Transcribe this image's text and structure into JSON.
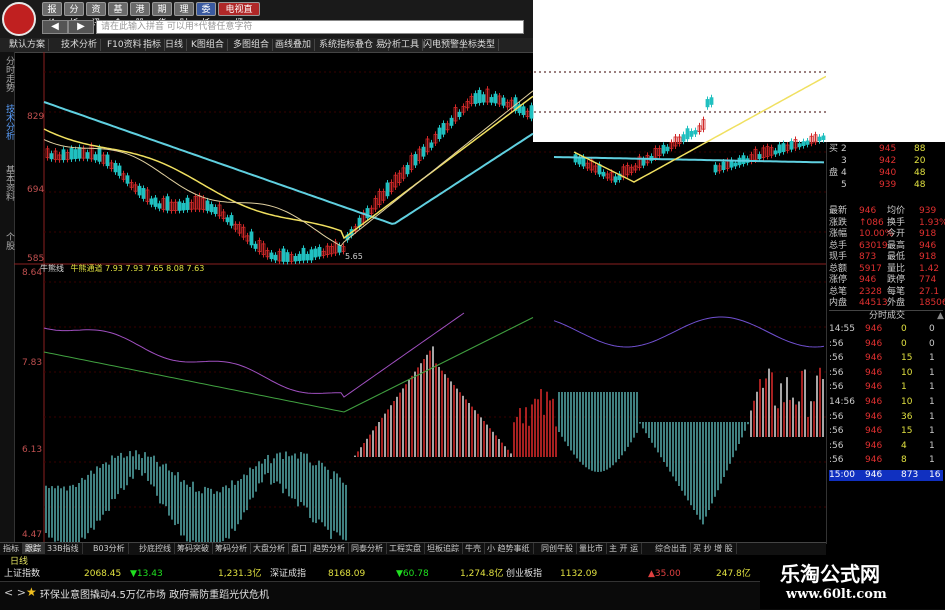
{
  "toolbar_top": {
    "buttons": [
      "报价",
      "分析",
      "资讯",
      "基金",
      "港股",
      "期货",
      "理财",
      "委托",
      "电视直播"
    ],
    "search_placeholder": "请在此输入拼音 可以用*代替任意字符",
    "back": "◀",
    "forward": "▶"
  },
  "toolbar_main": [
    "默认方案",
    "技术分析",
    "F10资料",
    "指标",
    "日线",
    "K图组合",
    "多图组合",
    "画线叠加",
    "系统指标",
    "叠仓 易",
    "分析工具",
    "闪电预警",
    "坐标类型"
  ],
  "left_tabs": [
    "分时走势",
    "技术分析",
    "基本资料",
    "个股"
  ],
  "price_axis_top": [
    "829",
    "694",
    "585"
  ],
  "price_axis_bottom": [
    "8.64",
    "7.83",
    "6.13",
    "4.47"
  ],
  "annotation": "5.65",
  "indicator_name": "牛熊线",
  "indicator_values": "牛熊通道  7.93  7.93  7.65  8.08  7.63",
  "quote": {
    "order_book": [
      {
        "side": "买",
        "level": "2",
        "price": "945",
        "vol": "88"
      },
      {
        "side": "",
        "level": "3",
        "price": "942",
        "vol": "20"
      },
      {
        "side": "盘",
        "level": "4",
        "price": "940",
        "vol": "48"
      },
      {
        "side": "",
        "level": "5",
        "price": "939",
        "vol": "48"
      }
    ],
    "stats": [
      {
        "k1": "最新",
        "v1": "946",
        "k2": "均价",
        "v2": "939"
      },
      {
        "k1": "涨跌",
        "v1": "↑086",
        "k2": "换手",
        "v2": "1.93%"
      },
      {
        "k1": "涨幅",
        "v1": "10.00%",
        "k2": "今开",
        "v2": "918"
      },
      {
        "k1": "总手",
        "v1": "63019",
        "k2": "最高",
        "v2": "946"
      },
      {
        "k1": "现手",
        "v1": "873",
        "k2": "最低",
        "v2": "918"
      },
      {
        "k1": "总额",
        "v1": "5917",
        "k2": "量比",
        "v2": "1.42"
      },
      {
        "k1": "涨停",
        "v1": "946",
        "k2": "跌停",
        "v2": "774"
      },
      {
        "k1": "总笔",
        "v1": "2328",
        "k2": "每笔",
        "v2": "27.1"
      },
      {
        "k1": "内盘",
        "v1": "44513",
        "k2": "外盘",
        "v2": "18506"
      }
    ],
    "ticks_title": "分时成交",
    "ticks": [
      {
        "time": "14:55",
        "price": "946",
        "vol": "0",
        "n": "0"
      },
      {
        "time": ":56",
        "price": "946",
        "vol": "0",
        "n": "0"
      },
      {
        "time": ":56",
        "price": "946",
        "vol": "15",
        "n": "1"
      },
      {
        "time": ":56",
        "price": "946",
        "vol": "10",
        "n": "1"
      },
      {
        "time": ":56",
        "price": "946",
        "vol": "1",
        "n": "1"
      },
      {
        "time": "14:56",
        "price": "946",
        "vol": "10",
        "n": "1"
      },
      {
        "time": ":56",
        "price": "946",
        "vol": "36",
        "n": "1"
      },
      {
        "time": ":56",
        "price": "946",
        "vol": "15",
        "n": "1"
      },
      {
        "time": ":56",
        "price": "946",
        "vol": "4",
        "n": "1"
      },
      {
        "time": ":56",
        "price": "946",
        "vol": "8",
        "n": "1"
      },
      {
        "time": "15:00",
        "price": "946",
        "vol": "873",
        "n": "16"
      }
    ]
  },
  "bottom_tabs": [
    "指标",
    "跟踪",
    "33B指线",
    "B03分析",
    "抄底控线",
    "筹码突破",
    "筹码分析",
    "大盘分析",
    "盘口",
    "趋势分析",
    "同泰分析",
    "工程实盘",
    "坦板追踪",
    "牛壳",
    "小 趋势事纸",
    "同创牛股",
    "量比市",
    "主 开 运",
    "综合出击",
    "买 抄 增 股"
  ],
  "status_line": [
    {
      "name": "上证指数",
      "value": "2068.45",
      "chg": "▼13.43",
      "amt": "1,231.3亿"
    },
    {
      "name": "深证成指",
      "value": "8168.09",
      "chg": "▼60.78",
      "amt": "1,274.8亿"
    },
    {
      "name": "创业板指",
      "value": "1132.09",
      "chg": "▲35.00",
      "amt": "247.8亿"
    }
  ],
  "ticker_text": "环保业意图撬动4.5万亿市场 政府需防重蹈光伏危机",
  "watermark": {
    "title": "乐淘公式网",
    "url": "www.60lt.com"
  },
  "timeline_label": "日线",
  "colors": {
    "up": "#d02828",
    "down": "#20c0c0",
    "ma1": "#f0e060",
    "ma2": "#60d0e0",
    "ma3": "#e0d0a0",
    "vol_up": "#a03030",
    "vol_down": "#50a0a0",
    "bg": "#000000"
  }
}
